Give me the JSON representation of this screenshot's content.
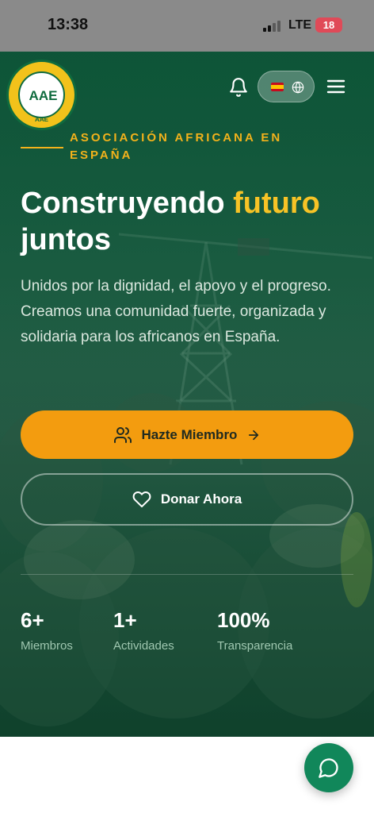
{
  "status_bar": {
    "time": "13:38",
    "network": "LTE",
    "battery": "18"
  },
  "header": {
    "logo_text": "AAE",
    "logo_subtext": "AAE",
    "notification_icon": "bell-icon",
    "language_flag": "spain-flag-icon",
    "language_icon": "globe-icon",
    "menu_icon": "hamburger-menu-icon"
  },
  "hero": {
    "tag": "ASOCIACIÓN AFRICANA EN ESPAÑA",
    "headline_part1": "Construyendo",
    "headline_accent": "futuro",
    "headline_part2": "juntos",
    "description": "Unidos por la dignidad, el apoyo y el progreso. Creamos una comunidad fuerte, organizada y solidaria para los africanos en España.",
    "primary_button": "Hazte Miembro",
    "secondary_button": "Donar Ahora"
  },
  "stats": [
    {
      "value": "6+",
      "label": "Miembros"
    },
    {
      "value": "1+",
      "label": "Actividades"
    },
    {
      "value": "100%",
      "label": "Transparencia"
    }
  ],
  "colors": {
    "brand_green": "#0f6b3e",
    "accent_yellow": "#f7c326",
    "button_orange": "#f39c0f",
    "fab_green": "#11875a"
  },
  "fab": {
    "icon": "chat-bubble-icon"
  }
}
